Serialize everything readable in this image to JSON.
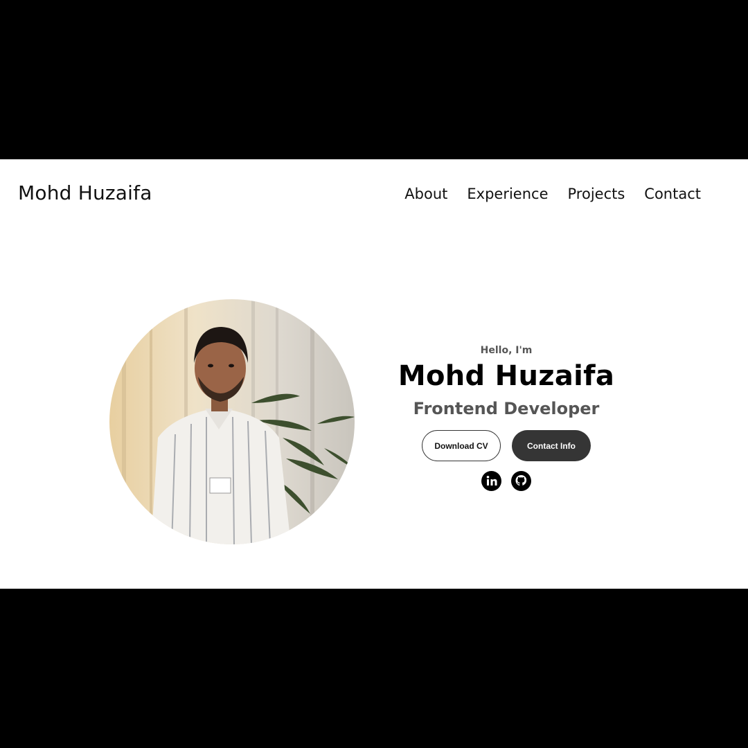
{
  "header": {
    "logo": "Mohd Huzaifa",
    "nav": [
      {
        "label": "About"
      },
      {
        "label": "Experience"
      },
      {
        "label": "Projects"
      },
      {
        "label": "Contact"
      }
    ]
  },
  "hero": {
    "greeting": "Hello, I'm",
    "name": "Mohd Huzaifa",
    "title": "Frontend Developer",
    "buttons": {
      "download_cv": "Download CV",
      "contact_info": "Contact Info"
    },
    "socials": [
      {
        "icon": "linkedin-icon"
      },
      {
        "icon": "github-icon"
      }
    ]
  },
  "colors": {
    "background": "#ffffff",
    "text": "#111111",
    "muted_text": "#555555",
    "button_dark": "#353535"
  }
}
